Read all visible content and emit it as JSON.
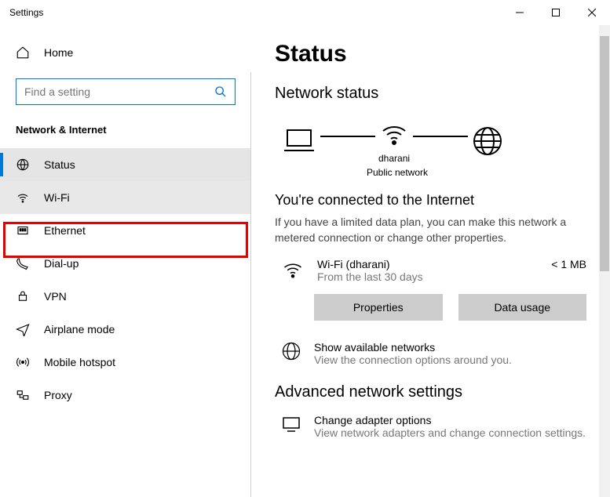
{
  "window": {
    "title": "Settings"
  },
  "sidebar": {
    "home": "Home",
    "search_placeholder": "Find a setting",
    "category": "Network & Internet",
    "items": [
      {
        "label": "Status"
      },
      {
        "label": "Wi-Fi"
      },
      {
        "label": "Ethernet"
      },
      {
        "label": "Dial-up"
      },
      {
        "label": "VPN"
      },
      {
        "label": "Airplane mode"
      },
      {
        "label": "Mobile hotspot"
      },
      {
        "label": "Proxy"
      }
    ]
  },
  "main": {
    "page_title": "Status",
    "network_status_title": "Network status",
    "diagram": {
      "network_name": "dharani",
      "network_type": "Public network"
    },
    "connected_title": "You're connected to the Internet",
    "connected_desc": "If you have a limited data plan, you can make this network a metered connection or change other properties.",
    "active_connection": {
      "name": "Wi-Fi (dharani)",
      "period": "From the last 30 days",
      "usage": "< 1 MB"
    },
    "buttons": {
      "properties": "Properties",
      "data_usage": "Data usage"
    },
    "show_networks": {
      "title": "Show available networks",
      "desc": "View the connection options around you."
    },
    "advanced_title": "Advanced network settings",
    "adapter": {
      "title": "Change adapter options",
      "desc": "View network adapters and change connection settings."
    }
  }
}
